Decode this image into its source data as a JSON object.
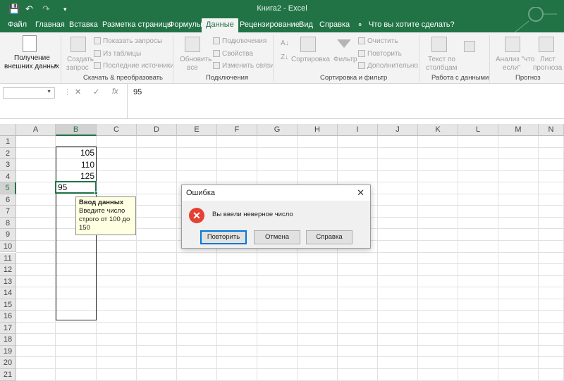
{
  "window": {
    "title": "Книга2  -  Excel",
    "qa_icons": [
      "save-icon",
      "undo-icon",
      "redo-icon",
      "customize-icon"
    ]
  },
  "tabs": [
    {
      "label": "Файл"
    },
    {
      "label": "Главная"
    },
    {
      "label": "Вставка"
    },
    {
      "label": "Разметка страницы"
    },
    {
      "label": "Формулы"
    },
    {
      "label": "Данные",
      "active": true
    },
    {
      "label": "Рецензирование"
    },
    {
      "label": "Вид"
    },
    {
      "label": "Справка"
    }
  ],
  "tell_me": "Что вы хотите сделать?",
  "ribbon": {
    "get_data": {
      "line1": "Получение",
      "line2": "внешних данных"
    },
    "new_query": {
      "line1": "Создать",
      "line2": "запрос"
    },
    "show_queries": "Показать запросы",
    "from_table": "Из таблицы",
    "recent_sources": "Последние источники",
    "group_get_transform": "Скачать & преобразовать",
    "refresh": {
      "line1": "Обновить",
      "line2": "все"
    },
    "connections": "Подключения",
    "properties": "Свойства",
    "edit_links": "Изменить связи",
    "group_connections": "Подключения",
    "sort": "Сортировка",
    "filter": "Фильтр",
    "clear": "Очистить",
    "reapply": "Повторить",
    "advanced": "Дополнительно",
    "group_sort_filter": "Сортировка и фильтр",
    "text_to_columns": {
      "line1": "Текст по",
      "line2": "столбцам"
    },
    "group_data_tools": "Работа с данными",
    "what_if": {
      "line1": "Анализ \"что",
      "line2": "если\""
    },
    "forecast_sheet": {
      "line1": "Лист",
      "line2": "прогноза"
    },
    "group_forecast": "Прогноз"
  },
  "formula_bar": {
    "name_box": "",
    "cancel": "✕",
    "enter": "✓",
    "fx": "fx",
    "value": "95"
  },
  "sheet": {
    "columns": [
      "A",
      "B",
      "C",
      "D",
      "E",
      "F",
      "G",
      "H",
      "I",
      "J",
      "K",
      "L",
      "M",
      "N"
    ],
    "rows": [
      "1",
      "2",
      "3",
      "4",
      "5",
      "6",
      "7",
      "8",
      "9",
      "10",
      "11",
      "12",
      "13",
      "14",
      "15",
      "16",
      "17",
      "18",
      "19",
      "20",
      "21"
    ],
    "cells": {
      "B2": "105",
      "B3": "110",
      "B4": "125",
      "B5": "95"
    }
  },
  "tooltip": {
    "title": "Ввод данных",
    "line1": "Введите число",
    "line2": "строго от 100 до",
    "line3": "150"
  },
  "dialog": {
    "title": "Ошибка",
    "close": "✕",
    "message": "Вы ввели неверное число",
    "retry": "Повторить",
    "cancel": "Отмена",
    "help": "Справка"
  }
}
